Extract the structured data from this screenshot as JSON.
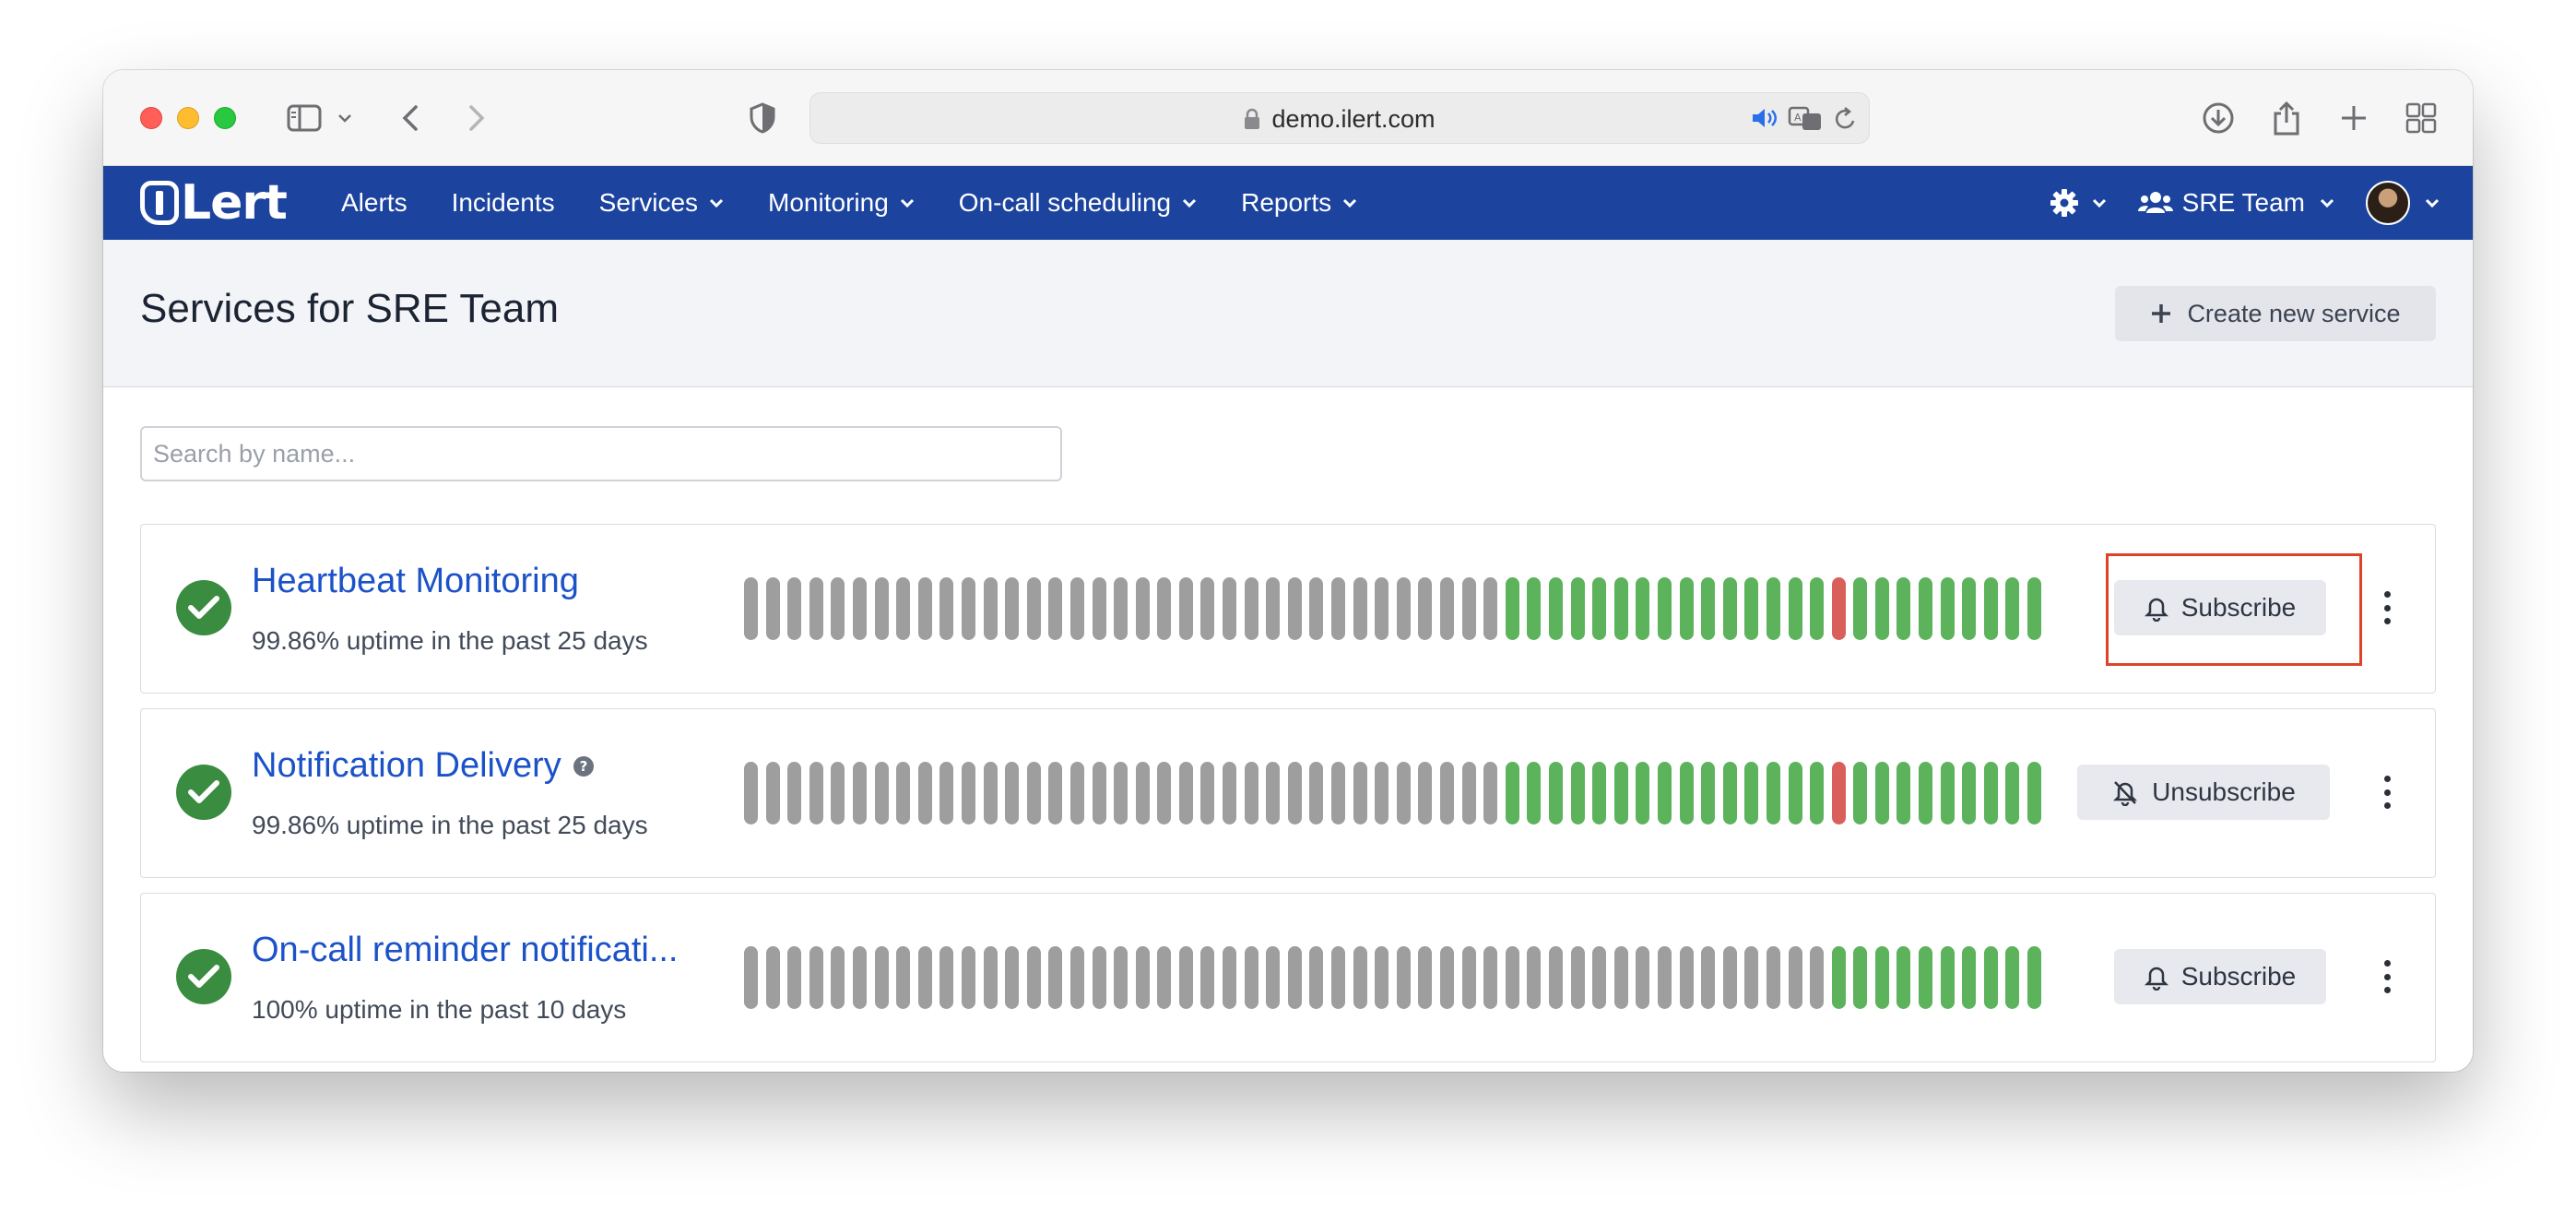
{
  "browser": {
    "url": "demo.ilert.com"
  },
  "app": {
    "logo": "iLert",
    "nav": {
      "items": [
        {
          "label": "Alerts",
          "dropdown": false
        },
        {
          "label": "Incidents",
          "dropdown": false
        },
        {
          "label": "Services",
          "dropdown": true
        },
        {
          "label": "Monitoring",
          "dropdown": true
        },
        {
          "label": "On-call scheduling",
          "dropdown": true
        },
        {
          "label": "Reports",
          "dropdown": true
        }
      ],
      "team": "SRE Team"
    }
  },
  "page": {
    "title": "Services for SRE Team",
    "create_button": "Create new service",
    "search_placeholder": "Search by name..."
  },
  "colors": {
    "navbar": "#1c449f",
    "up": "#5cb35c",
    "down": "#d9605a",
    "no_data": "#9e9e9e",
    "link": "#1c52c8",
    "highlight": "#dd4328"
  },
  "services": [
    {
      "name": "Heartbeat Monitoring",
      "has_help": false,
      "uptime": "99.86% uptime in the past 25 days",
      "action": "Subscribe",
      "bars": "GGGGGGGGGGGGGGGGGGGGGGGGGGGGGGGGGGGUUUUUUUUUUUUUUUDUUUUUUUUU"
    },
    {
      "name": "Notification Delivery",
      "has_help": true,
      "uptime": "99.86% uptime in the past 25 days",
      "action": "Unsubscribe",
      "bars": "GGGGGGGGGGGGGGGGGGGGGGGGGGGGGGGGGGGUUUUUUUUUUUUUUUDUUUUUUUUU"
    },
    {
      "name": "On-call reminder notificati...",
      "has_help": false,
      "uptime": "100% uptime in the past 10 days",
      "action": "Subscribe",
      "bars": "GGGGGGGGGGGGGGGGGGGGGGGGGGGGGGGGGGGGGGGGGGGGGGGGGGUUUUUUUUUU"
    }
  ]
}
